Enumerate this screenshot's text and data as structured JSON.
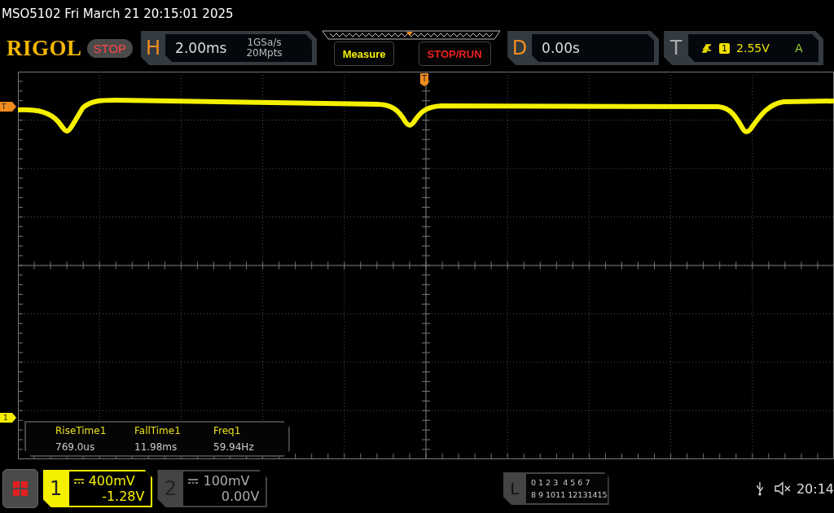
{
  "status_line": "MSO5102  Fri March 21 20:15:01 2025",
  "logo": "RIGOL",
  "run_state": "STOP",
  "horizontal": {
    "label": "H",
    "timebase": "2.00ms",
    "sample_rate": "1GSa/s",
    "memory_depth": "20Mpts"
  },
  "buttons": [
    "Measure",
    "STOP/RUN"
  ],
  "delay": {
    "label": "D",
    "value": "0.00s"
  },
  "trigger": {
    "label": "T",
    "source": "1",
    "level": "2.55V",
    "mode": "A"
  },
  "markers": {
    "trigger_level": "T",
    "trigger_position": "T",
    "channel_1": "1"
  },
  "measurements": [
    {
      "name": "RiseTime1",
      "value": "769.0us"
    },
    {
      "name": "FallTime1",
      "value": "11.98ms"
    },
    {
      "name": "Freq1",
      "value": "59.94Hz"
    }
  ],
  "channels": [
    {
      "number": "1",
      "scale": "400mV",
      "offset": "-1.28V",
      "on": true
    },
    {
      "number": "2",
      "scale": "100mV",
      "offset": "0.00V",
      "on": false
    }
  ],
  "logic": {
    "label": "L",
    "rows": [
      "0 1 2 3  4 5 6 7",
      "8 9 1011 12131415"
    ]
  },
  "clock": "20:14"
}
